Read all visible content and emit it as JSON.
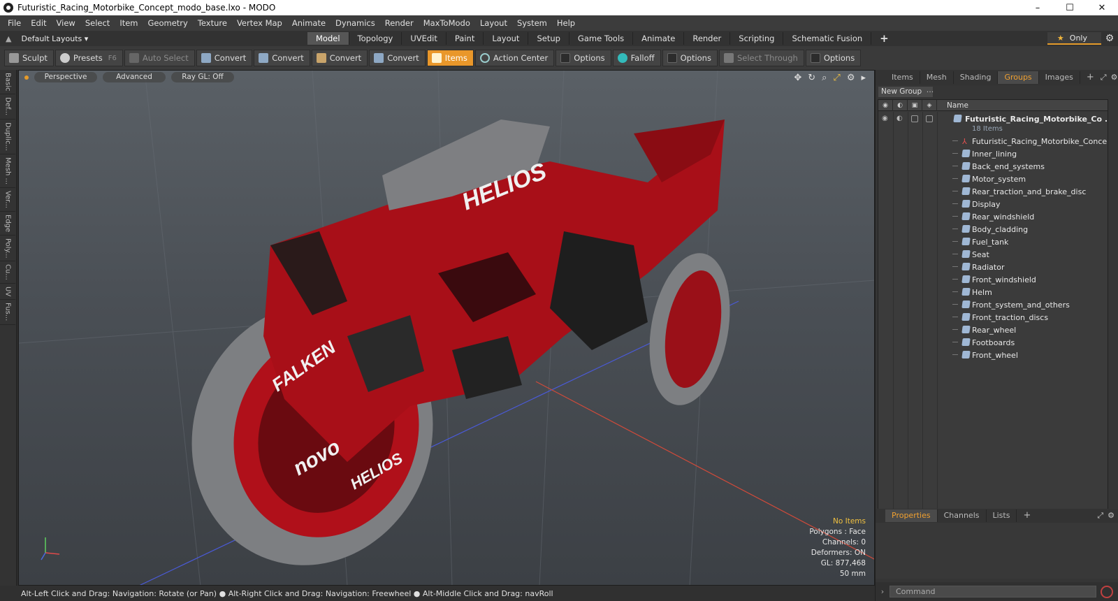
{
  "window": {
    "title": "Futuristic_Racing_Motorbike_Concept_modo_base.lxo - MODO",
    "controls": [
      "–",
      "☐",
      "✕"
    ]
  },
  "menu": [
    "File",
    "Edit",
    "View",
    "Select",
    "Item",
    "Geometry",
    "Texture",
    "Vertex Map",
    "Animate",
    "Dynamics",
    "Render",
    "MaxToModo",
    "Layout",
    "System",
    "Help"
  ],
  "layouts": {
    "label": "Default Layouts ▾",
    "tabs": [
      "Model",
      "Topology",
      "UVEdit",
      "Paint",
      "Layout",
      "Setup",
      "Game Tools",
      "Animate",
      "Render",
      "Scripting",
      "Schematic Fusion"
    ],
    "active_tab": "Model",
    "add": "+",
    "only_label": "Only"
  },
  "toolbar": {
    "sculpt": "Sculpt",
    "presets": "Presets",
    "presets_key": "F6",
    "auto_select": "Auto Select",
    "convert": "Convert",
    "items": "Items",
    "action_center": "Action Center",
    "options": "Options",
    "falloff": "Falloff",
    "select_through": "Select Through"
  },
  "left_strip": [
    "Basic",
    "Def...",
    "Duplic...",
    "Mesh ...",
    "Ver...",
    "Edge",
    "Poly...",
    "Cu...",
    "UV",
    "Fus..."
  ],
  "viewport": {
    "view": "Perspective",
    "shading": "Advanced",
    "raygl": "Ray GL: Off",
    "info": {
      "selection": "No Items",
      "polygons": "Polygons : Face",
      "channels": "Channels: 0",
      "deformers": "Deformers: ON",
      "gl": "GL: 877,468",
      "scale": "50 mm"
    }
  },
  "status": "Alt-Left Click and Drag: Navigation: Rotate (or Pan) ● Alt-Right Click and Drag: Navigation: Freewheel ● Alt-Middle Click and Drag: navRoll",
  "right_panel": {
    "tabs": [
      "Items",
      "Mesh ...",
      "Shading",
      "Groups",
      "Images"
    ],
    "active_tab": "Groups",
    "new_group": "New Group",
    "column_name": "Name",
    "group": {
      "name": "Futuristic_Racing_Motorbike_Co ...",
      "count": "18 Items",
      "children": [
        "Futuristic_Racing_Motorbike_Concept",
        "Inner_lining",
        "Back_end_systems",
        "Motor_system",
        "Rear_traction_and_brake_disc",
        "Display",
        "Rear_windshield",
        "Body_cladding",
        "Fuel_tank",
        "Seat",
        "Radiator",
        "Front_windshield",
        "Helm",
        "Front_system_and_others",
        "Front_traction_discs",
        "Rear_wheel",
        "Footboards",
        "Front_wheel"
      ]
    },
    "bottom_tabs": [
      "Properties",
      "Channels",
      "Lists"
    ],
    "bottom_active": "Properties",
    "command_placeholder": "Command"
  },
  "colors": {
    "accent": "#e9972a",
    "bike_red": "#b0101a",
    "tire": "#8a8a8a"
  }
}
